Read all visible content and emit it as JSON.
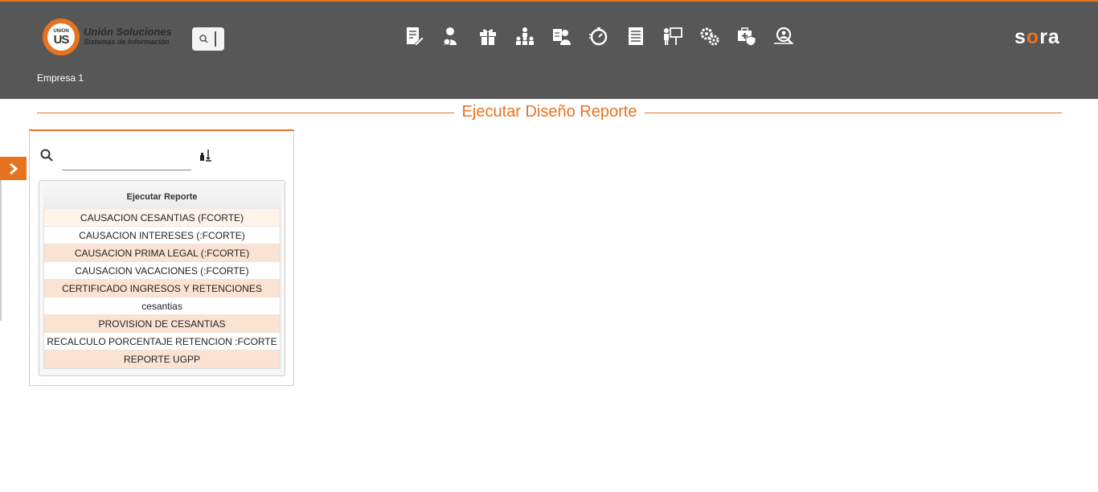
{
  "header": {
    "logo": {
      "line1": "Unión Soluciones",
      "line2": "Sistemas de Información",
      "badge_small": "UNION",
      "badge_big": "US"
    },
    "brand": {
      "part1": "s",
      "part2": "o",
      "part3": "ra"
    },
    "company": "Empresa 1",
    "nav_icons": [
      "edit-document-icon",
      "person-money-icon",
      "gift-icon",
      "org-chart-icon",
      "id-card-person-icon",
      "stopwatch-icon",
      "document-list-icon",
      "presentation-icon",
      "gears-icon",
      "medical-shield-icon",
      "search-people-icon"
    ]
  },
  "page": {
    "title": "Ejecutar Diseño Reporte"
  },
  "panel": {
    "search_value": "",
    "report_header": "Ejecutar Reporte",
    "reports": [
      "CAUSACION CESANTIAS (FCORTE)",
      "CAUSACION INTERESES (:FCORTE)",
      "CAUSACION PRIMA LEGAL (:FCORTE)",
      "CAUSACION VACACIONES (:FCORTE)",
      "CERTIFICADO INGRESOS Y RETENCIONES",
      "cesantias",
      "PROVISION DE CESANTIAS",
      "RECALCULO PORCENTAJE RETENCION :FCORTE",
      "REPORTE UGPP"
    ]
  },
  "colors": {
    "accent": "#e8731f",
    "header_bg": "#575757",
    "row_highlight": "#fbe3d3"
  }
}
